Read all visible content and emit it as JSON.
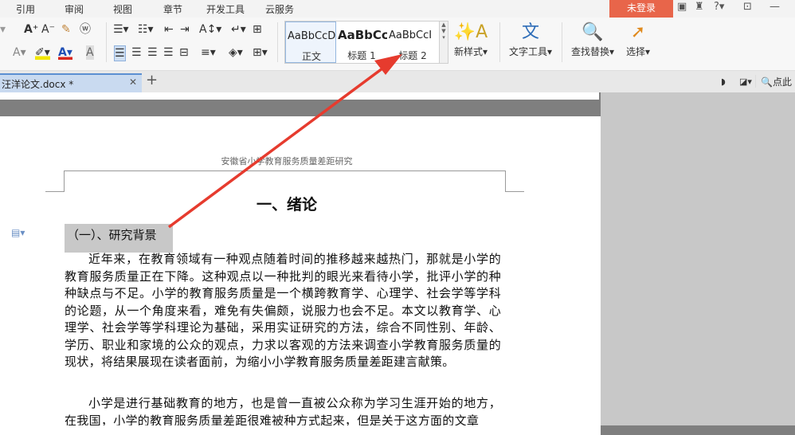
{
  "menubar": {
    "items": [
      "引用",
      "审阅",
      "视图",
      "章节",
      "开发工具",
      "云服务"
    ],
    "login_label": "未登录",
    "icons": [
      "box-icon",
      "shirt-icon",
      "help-icon",
      "restore-icon",
      "minimize-icon"
    ],
    "help_glyph": "?"
  },
  "ribbon": {
    "styles": [
      {
        "sample": "AaBbCcD",
        "name": "正文"
      },
      {
        "sample": "AaBbCc",
        "name": "标题 1"
      },
      {
        "sample": "AaBbCcI",
        "name": "标题 2"
      }
    ],
    "new_style_label": "新样式",
    "text_tools_label": "文字工具",
    "find_replace_label": "查找替换",
    "select_label": "选择"
  },
  "tabbar": {
    "doc_tab_label": "汪洋论文.docx *",
    "search_label": "点此"
  },
  "document": {
    "header": "安徽省小学教育服务质量差距研究",
    "heading": "一、绪论",
    "subheading": "（一）、研究背景",
    "paragraphs": [
      "近年来，在教育领域有一种观点随着时间的推移越来越热门，那就是小学的教育服务质量正在下降。这种观点以一种批判的眼光来看待小学，批评小学的种种缺点与不足。小学的教育服务质量是一个横跨教育学、心理学、社会学等学科的论题，从一个角度来看，难免有失偏颇，说服力也会不足。本文以教育学、心理学、社会学等学科理论为基础，采用实证研究的方法，综合不同性别、年龄、学历、职业和家境的公众的观点，力求以客观的方法来调查小学教育服务质量的现状，将结果展现在读者面前，为缩小小学教育服务质量差距建言献策。",
      "小学是进行基础教育的地方，也是曾一直被公众称为学习生涯开始的地方，在我国，小学的教育服务质量差距很难被种方式起来，但是关于这方面的文章"
    ]
  },
  "annotation": {
    "arrow_color": "#e63b2e"
  }
}
